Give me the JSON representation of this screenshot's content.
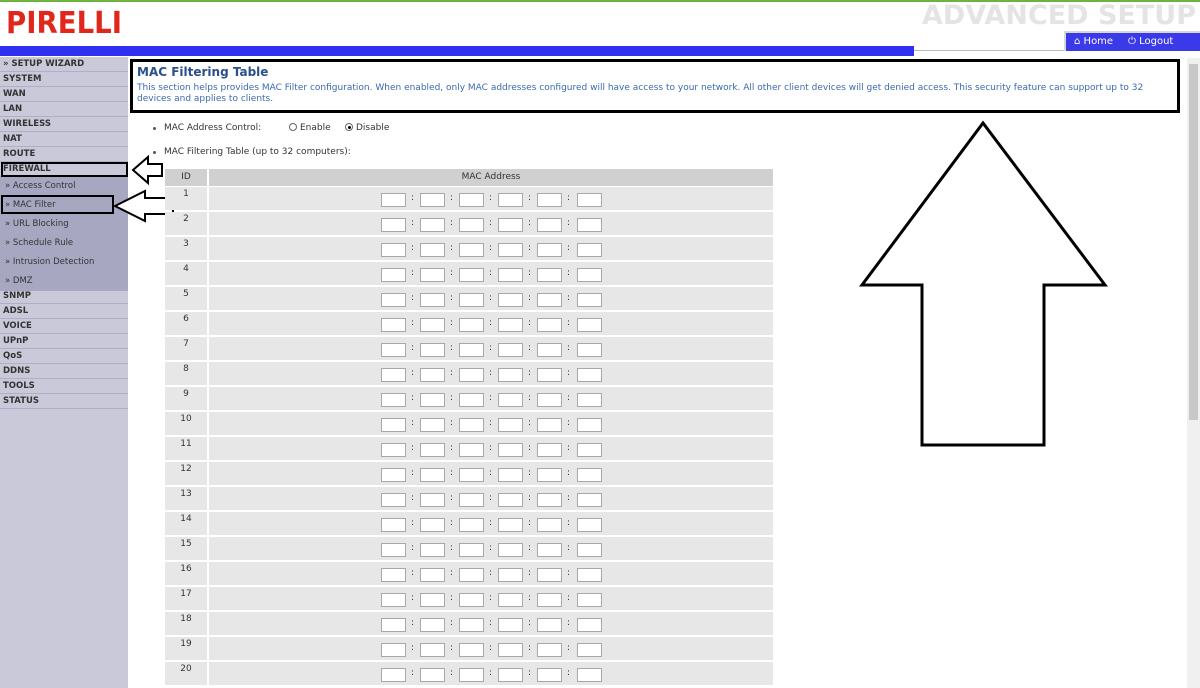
{
  "header": {
    "logo_text": "PIRELLI",
    "section_title": "ADVANCED SETUP",
    "home_label": "Home",
    "logout_label": "Logout"
  },
  "sidebar": {
    "items": [
      {
        "label": "» SETUP WIZARD"
      },
      {
        "label": "SYSTEM"
      },
      {
        "label": "WAN"
      },
      {
        "label": "LAN"
      },
      {
        "label": "WIRELESS"
      },
      {
        "label": "NAT"
      },
      {
        "label": "ROUTE"
      },
      {
        "label": "FIREWALL"
      }
    ],
    "sub_items": [
      {
        "label": "» Access Control"
      },
      {
        "label": "» MAC Filter"
      },
      {
        "label": "» URL Blocking"
      },
      {
        "label": "» Schedule Rule"
      },
      {
        "label": "» Intrusion Detection"
      },
      {
        "label": "» DMZ"
      }
    ],
    "items_after": [
      {
        "label": "SNMP"
      },
      {
        "label": "ADSL"
      },
      {
        "label": "VOICE"
      },
      {
        "label": "UPnP"
      },
      {
        "label": "QoS"
      },
      {
        "label": "DDNS"
      },
      {
        "label": "TOOLS"
      },
      {
        "label": "STATUS"
      }
    ]
  },
  "main": {
    "title": "MAC Filtering Table",
    "description": "This section helps provides MAC Filter configuration. When enabled, only MAC addresses configured will have access to your network. All other client devices will get denied access. This security feature can support up to 32 devices and applies to clients.",
    "control_label": "MAC Address Control:",
    "enable_label": "Enable",
    "disable_label": "Disable",
    "selected": "disable",
    "table_label": "MAC Filtering Table (up to 32 computers):",
    "table": {
      "col_id": "ID",
      "col_mac": "MAC Address",
      "rows": [
        "1",
        "2",
        "3",
        "4",
        "5",
        "6",
        "7",
        "8",
        "9",
        "10",
        "11",
        "12",
        "13",
        "14",
        "15",
        "16",
        "17",
        "18",
        "19",
        "20"
      ]
    }
  },
  "colors": {
    "accent_blue": "#3030f0",
    "title_blue": "#2b4f8c",
    "logo_red": "#e1261c"
  }
}
